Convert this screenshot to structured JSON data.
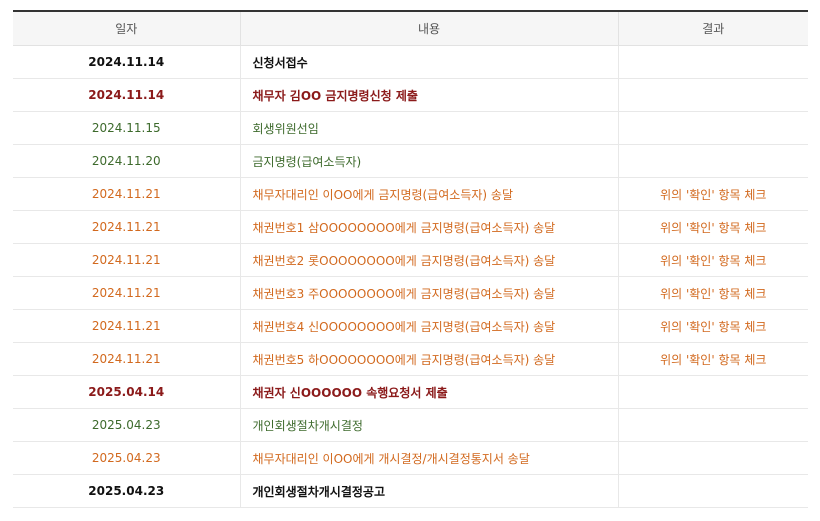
{
  "table": {
    "headers": {
      "date": "일자",
      "content": "내용",
      "result": "결과"
    },
    "rows": [
      {
        "date": "2024.11.14",
        "content": "신청서접수",
        "result": "",
        "style": "black"
      },
      {
        "date": "2024.11.14",
        "content": "채무자 김OO 금지명령신청 제출",
        "result": "",
        "style": "maroon"
      },
      {
        "date": "2024.11.15",
        "content": "회생위원선임",
        "result": "",
        "style": "green"
      },
      {
        "date": "2024.11.20",
        "content": "금지명령(급여소득자)",
        "result": "",
        "style": "green"
      },
      {
        "date": "2024.11.21",
        "content": "채무자대리인 이OO에게 금지명령(급여소득자) 송달",
        "result": "위의 '확인' 항목 체크",
        "style": "orange"
      },
      {
        "date": "2024.11.21",
        "content": "채권번호1 삼OOOOOOOO에게 금지명령(급여소득자) 송달",
        "result": "위의 '확인' 항목 체크",
        "style": "orange"
      },
      {
        "date": "2024.11.21",
        "content": "채권번호2 롯OOOOOOOO에게 금지명령(급여소득자) 송달",
        "result": "위의 '확인' 항목 체크",
        "style": "orange"
      },
      {
        "date": "2024.11.21",
        "content": "채권번호3 주OOOOOOOO에게 금지명령(급여소득자) 송달",
        "result": "위의 '확인' 항목 체크",
        "style": "orange"
      },
      {
        "date": "2024.11.21",
        "content": "채권번호4 신OOOOOOOO에게 금지명령(급여소득자) 송달",
        "result": "위의 '확인' 항목 체크",
        "style": "orange"
      },
      {
        "date": "2024.11.21",
        "content": "채권번호5 하OOOOOOOO에게 금지명령(급여소득자) 송달",
        "result": "위의 '확인' 항목 체크",
        "style": "orange"
      },
      {
        "date": "2025.04.14",
        "content": "채권자 신OOOOOO 속행요청서 제출",
        "result": "",
        "style": "maroon"
      },
      {
        "date": "2025.04.23",
        "content": "개인회생절차개시결정",
        "result": "",
        "style": "green"
      },
      {
        "date": "2025.04.23",
        "content": "채무자대리인 이OO에게 개시결정/개시결정통지서 송달",
        "result": "",
        "style": "orange"
      },
      {
        "date": "2025.04.23",
        "content": "개인회생절차개시결정공고",
        "result": "",
        "style": "black"
      }
    ]
  },
  "colors": {
    "black": "#111111",
    "maroon": "#8b1a1a",
    "green": "#3d6a2c",
    "orange": "#d2691e",
    "header_bg": "#f6f6f6",
    "header_border_top": "#333333"
  }
}
